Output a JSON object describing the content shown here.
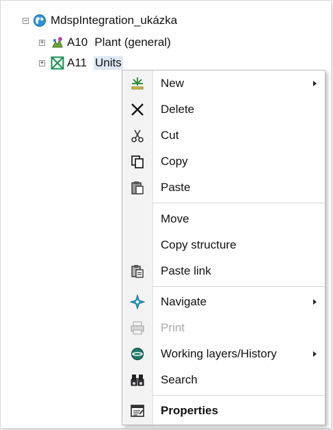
{
  "tree": {
    "root": {
      "expander": "⊟",
      "icon": "globe-icon",
      "label": "MdspIntegration_ukázka"
    },
    "children": [
      {
        "expander": "+",
        "icon": "plant-icon",
        "code": "A10",
        "label": "Plant (general)"
      },
      {
        "expander": "+",
        "icon": "units-icon",
        "code": "A11",
        "label": "Units"
      }
    ]
  },
  "context_menu": {
    "items": [
      {
        "label": "New",
        "icon": "new-icon",
        "submenu": true
      },
      {
        "label": "Delete",
        "icon": "delete-icon"
      },
      {
        "label": "Cut",
        "icon": "scissors-icon"
      },
      {
        "label": "Copy",
        "icon": "copy-icon"
      },
      {
        "label": "Paste",
        "icon": "paste-icon"
      },
      {
        "label": "Move",
        "icon": ""
      },
      {
        "label": "Copy structure",
        "icon": ""
      },
      {
        "label": "Paste link",
        "icon": "paste-link-icon"
      },
      {
        "label": "Navigate",
        "icon": "navigate-icon",
        "submenu": true
      },
      {
        "label": "Print",
        "icon": "printer-icon",
        "disabled": true
      },
      {
        "label": "Working layers/History",
        "icon": "layers-icon",
        "submenu": true
      },
      {
        "label": "Search",
        "icon": "binoculars-icon"
      },
      {
        "label": "Properties",
        "icon": "properties-icon",
        "bold": true
      }
    ]
  }
}
